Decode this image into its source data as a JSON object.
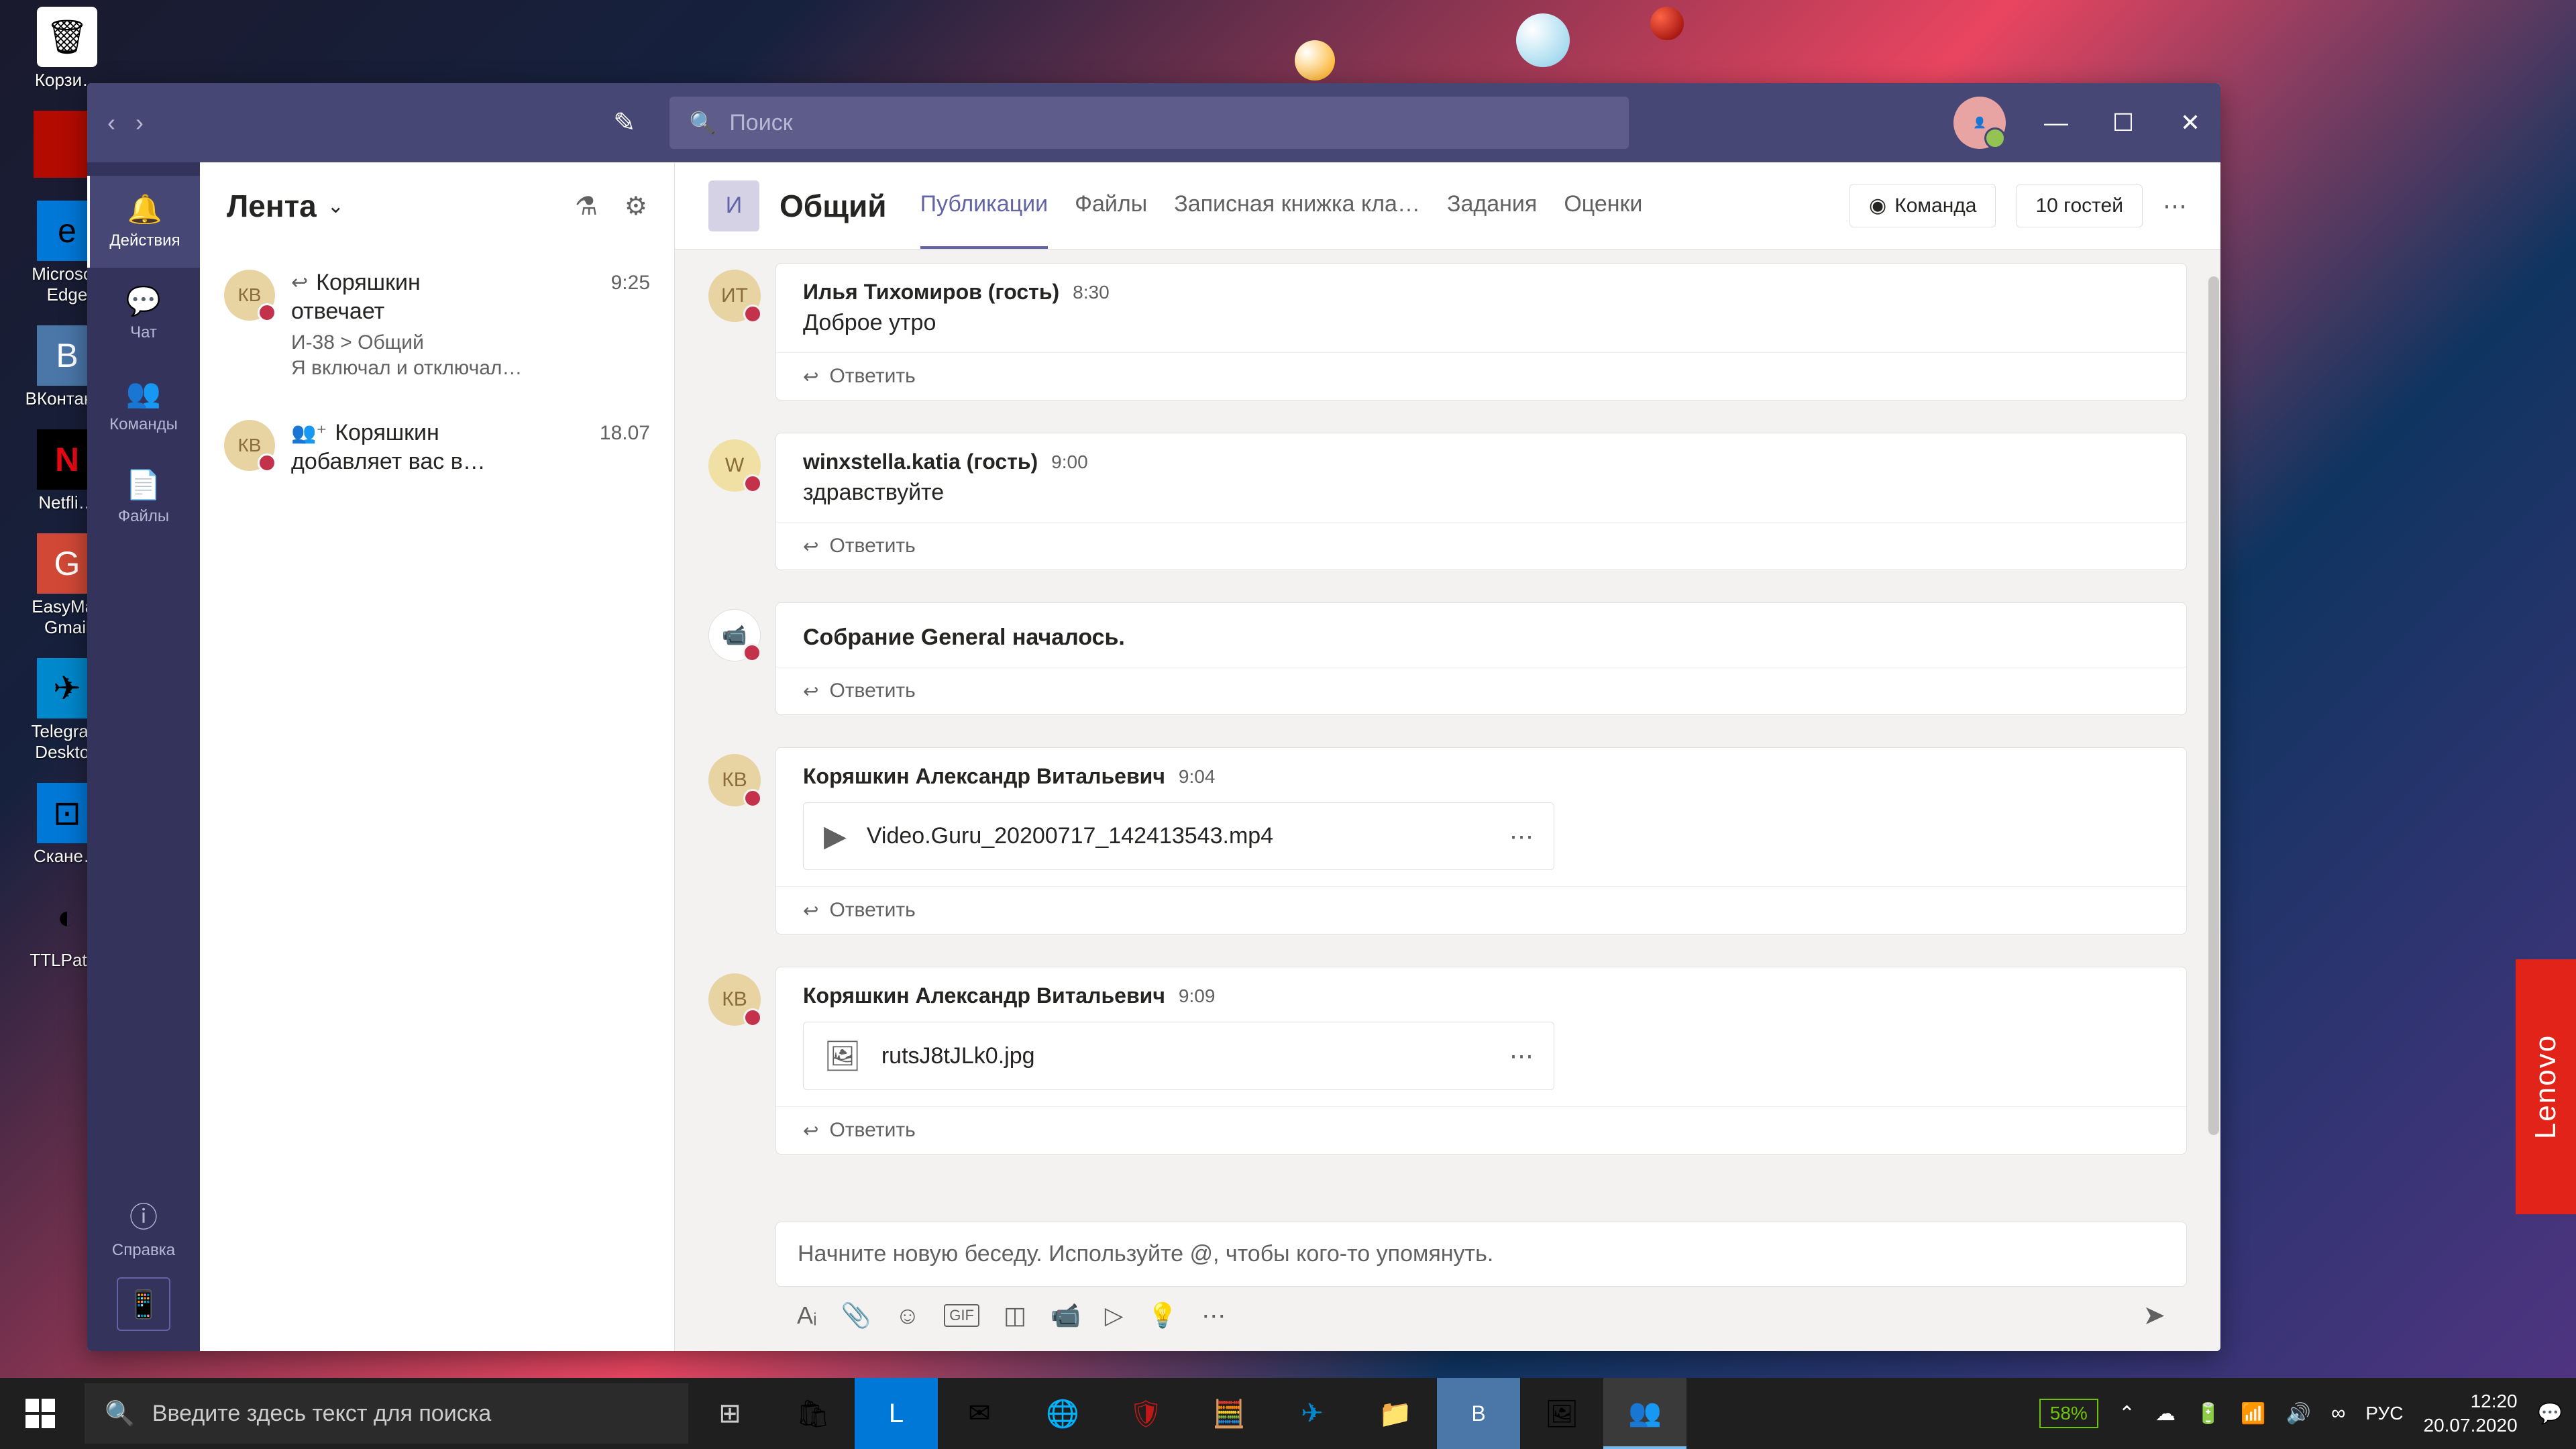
{
  "desktop": {
    "icons": [
      {
        "label": "Корзи…",
        "cls": "recycle",
        "glyph": "🗑"
      },
      {
        "label": "",
        "cls": "adobe",
        "glyph": ""
      },
      {
        "label": "Microsoft Edge",
        "cls": "edge",
        "glyph": "e"
      },
      {
        "label": "ВКонтак…",
        "cls": "vk",
        "glyph": "B"
      },
      {
        "label": "Netfli…",
        "cls": "netflix",
        "glyph": "N"
      },
      {
        "label": "EasyMail Gmail",
        "cls": "gmail",
        "glyph": "G"
      },
      {
        "label": "Telegram Desktop",
        "cls": "telegram",
        "glyph": "✈"
      },
      {
        "label": "Скане…",
        "cls": "scanner",
        "glyph": "⊡"
      },
      {
        "label": "TTLPat…",
        "cls": "",
        "glyph": "◐"
      }
    ]
  },
  "titlebar": {
    "search_placeholder": "Поиск"
  },
  "rail": {
    "items": [
      {
        "label": "Действия",
        "icon": "🔔",
        "active": true
      },
      {
        "label": "Чат",
        "icon": "💬",
        "active": false
      },
      {
        "label": "Команды",
        "icon": "👥",
        "active": false
      },
      {
        "label": "Файлы",
        "icon": "📄",
        "active": false
      }
    ],
    "help_label": "Справка"
  },
  "feed": {
    "title": "Лента",
    "items": [
      {
        "avatar": "КВ",
        "type_icon": "↩",
        "name": "Коряшкин",
        "action": "отвечает",
        "time": "9:25",
        "channel": "И-38 > Общий",
        "preview": "Я включал и отключал…"
      },
      {
        "avatar": "КВ",
        "type_icon": "👥⁺",
        "name": "Коряшкин",
        "action": "добавляет вас в…",
        "time": "18.07",
        "channel": "",
        "preview": ""
      }
    ]
  },
  "channel": {
    "team_avatar": "И",
    "name": "Общий",
    "tabs": [
      "Публикации",
      "Файлы",
      "Записная книжка кла…",
      "Задания",
      "Оценки"
    ],
    "active_tab": 0,
    "team_btn": "Команда",
    "guests_btn": "10 гостей"
  },
  "messages": [
    {
      "avatar": "ИТ",
      "avatar_cls": "it",
      "author": "Илья Тихомиров (гость)",
      "time": "8:30",
      "text": "Доброе утро",
      "attachment": null
    },
    {
      "avatar": "W",
      "avatar_cls": "w",
      "author": "winxstella.katia (гость)",
      "time": "9:00",
      "text": "здравствуйте",
      "attachment": null
    },
    {
      "avatar": "📹",
      "avatar_cls": "meet",
      "author": "",
      "time": "",
      "text": "Собрание General началось.",
      "attachment": null,
      "is_system": true
    },
    {
      "avatar": "КВ",
      "avatar_cls": "kb",
      "author": "Коряшкин Александр Витальевич",
      "time": "9:04",
      "text": "",
      "attachment": {
        "icon": "▶",
        "name": "Video.Guru_20200717_142413543.mp4"
      }
    },
    {
      "avatar": "КВ",
      "avatar_cls": "kb",
      "author": "Коряшкин Александр Витальевич",
      "time": "9:09",
      "text": "",
      "attachment": {
        "icon": "🖼",
        "name": "rutsJ8tJLk0.jpg"
      }
    }
  ],
  "reply_label": "Ответить",
  "compose": {
    "placeholder": "Начните новую беседу. Используйте @, чтобы кого-то упомянуть."
  },
  "taskbar": {
    "search_text": "Введите здесь текст для поиска",
    "battery": "58%",
    "lang": "РУС",
    "time": "12:20",
    "date": "20.07.2020"
  },
  "lenovo": "Lenovo"
}
